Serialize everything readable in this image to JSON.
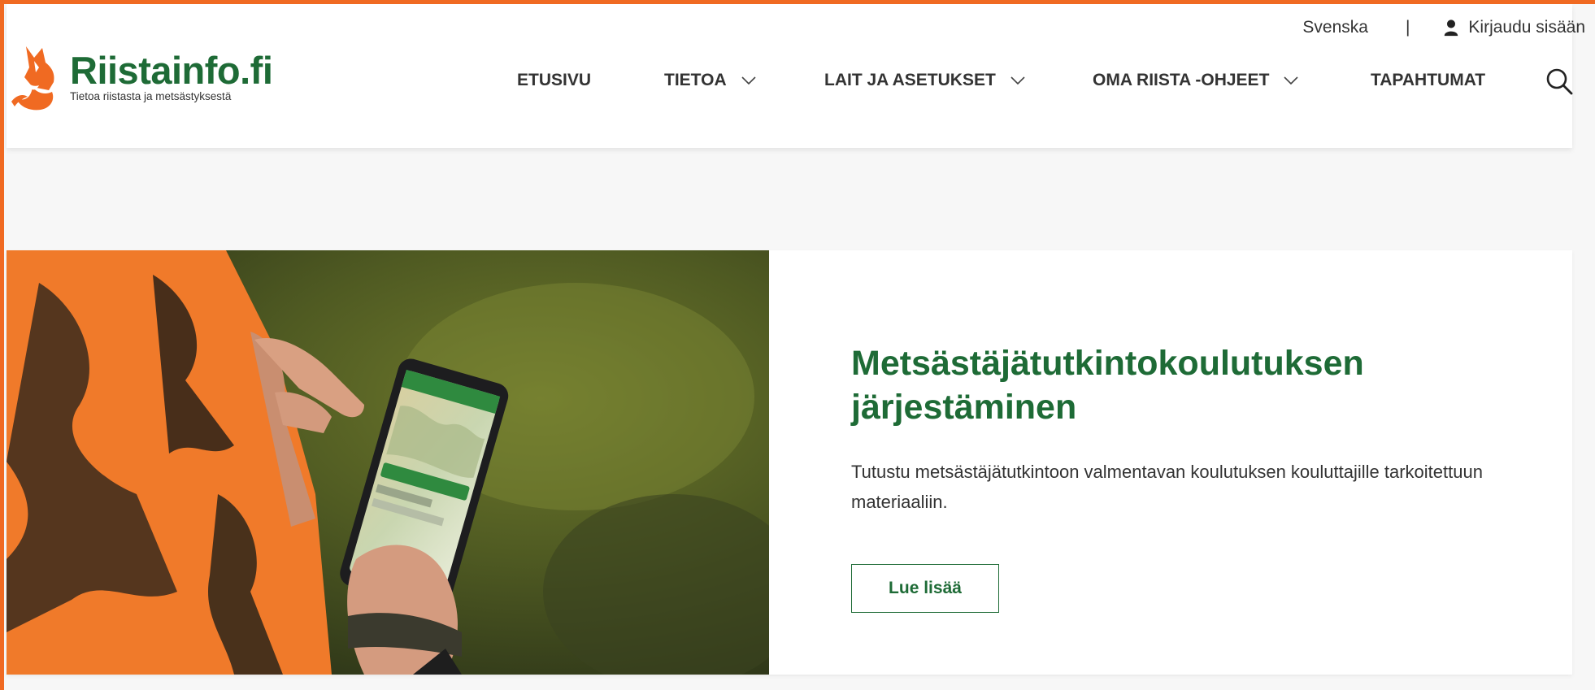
{
  "utility": {
    "language": "Svenska",
    "separator": "|",
    "login_label": "Kirjaudu sisään",
    "login_icon": "user-icon"
  },
  "logo": {
    "name": "Riistainfo.fi",
    "tagline": "Tietoa riistasta ja metsästyksestä",
    "icon": "fox-icon"
  },
  "nav": {
    "items": [
      {
        "label": "ETUSIVU",
        "has_dropdown": false
      },
      {
        "label": "TIETOA",
        "has_dropdown": true
      },
      {
        "label": "LAIT JA ASETUKSET",
        "has_dropdown": true
      },
      {
        "label": "OMA RIISTA -OHJEET",
        "has_dropdown": true
      },
      {
        "label": "TAPAHTUMAT",
        "has_dropdown": false
      }
    ],
    "search_icon": "search-icon"
  },
  "hero": {
    "title": "Metsästäjätutkintokoulutuksen järjestäminen",
    "description": "Tutustu metsästäjätutkintoon valmentavan koulutuksen kouluttajille tarkoitettuun materiaaliin.",
    "button_label": "Lue lisää"
  },
  "colors": {
    "brand_green": "#1e6b36",
    "brand_orange": "#f06a22",
    "text": "#333333",
    "background": "#f7f7f7"
  }
}
